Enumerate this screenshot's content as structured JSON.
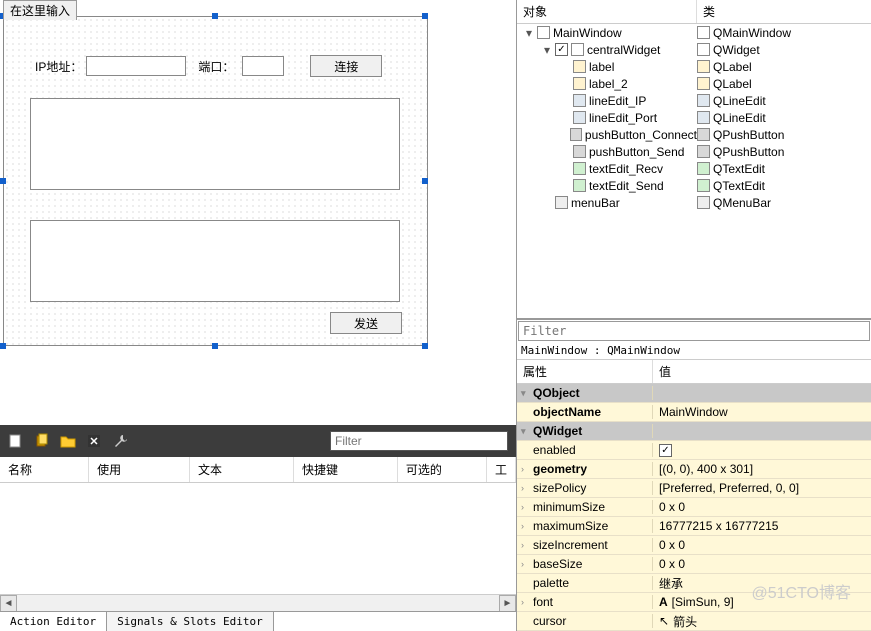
{
  "designer": {
    "tab_label": "在这里输入",
    "ip_label": "IP地址：",
    "port_label": "端口：",
    "connect_btn": "连接",
    "send_btn": "发送"
  },
  "action_filter_placeholder": "Filter",
  "action_headers": {
    "name": "名称",
    "use": "使用",
    "text": "文本",
    "shortcut": "快捷键",
    "optional": "可选的",
    "tool": "工"
  },
  "bottom_tabs": {
    "action": "Action Editor",
    "signals": "Signals & Slots Editor"
  },
  "obj_headers": {
    "obj": "对象",
    "cls": "类"
  },
  "obj_tree": [
    {
      "i": 0,
      "exp": "▾",
      "name": "MainWindow",
      "cls": "QMainWindow",
      "icon": "window"
    },
    {
      "i": 1,
      "exp": "▾",
      "name": "centralWidget",
      "cls": "QWidget",
      "icon": "window",
      "chk": true
    },
    {
      "i": 2,
      "exp": "",
      "name": "label",
      "cls": "QLabel",
      "icon": "label"
    },
    {
      "i": 2,
      "exp": "",
      "name": "label_2",
      "cls": "QLabel",
      "icon": "label"
    },
    {
      "i": 2,
      "exp": "",
      "name": "lineEdit_IP",
      "cls": "QLineEdit",
      "icon": "line"
    },
    {
      "i": 2,
      "exp": "",
      "name": "lineEdit_Port",
      "cls": "QLineEdit",
      "icon": "line"
    },
    {
      "i": 2,
      "exp": "",
      "name": "pushButton_Connect",
      "cls": "QPushButton",
      "icon": "btn"
    },
    {
      "i": 2,
      "exp": "",
      "name": "pushButton_Send",
      "cls": "QPushButton",
      "icon": "btn"
    },
    {
      "i": 2,
      "exp": "",
      "name": "textEdit_Recv",
      "cls": "QTextEdit",
      "icon": "text"
    },
    {
      "i": 2,
      "exp": "",
      "name": "textEdit_Send",
      "cls": "QTextEdit",
      "icon": "text"
    },
    {
      "i": 1,
      "exp": "",
      "name": "menuBar",
      "cls": "QMenuBar",
      "icon": "menu"
    }
  ],
  "prop_filter_placeholder": "Filter",
  "prop_path": "MainWindow : QMainWindow",
  "prop_headers": {
    "attr": "属性",
    "val": "值"
  },
  "properties": [
    {
      "type": "group",
      "key": "QObject",
      "exp": "▾"
    },
    {
      "type": "yellow",
      "key": "objectName",
      "val": "MainWindow",
      "bold": true
    },
    {
      "type": "group",
      "key": "QWidget",
      "exp": "▾"
    },
    {
      "type": "yellow",
      "key": "enabled",
      "val": "",
      "checkbox": true
    },
    {
      "type": "yellow",
      "key": "geometry",
      "val": "[(0, 0), 400 x 301]",
      "exp": "›",
      "bold": true
    },
    {
      "type": "yellow",
      "key": "sizePolicy",
      "val": "[Preferred, Preferred, 0, 0]",
      "exp": "›"
    },
    {
      "type": "yellow",
      "key": "minimumSize",
      "val": "0 x 0",
      "exp": "›"
    },
    {
      "type": "yellow",
      "key": "maximumSize",
      "val": "16777215 x 16777215",
      "exp": "›"
    },
    {
      "type": "yellow",
      "key": "sizeIncrement",
      "val": "0 x 0",
      "exp": "›"
    },
    {
      "type": "yellow",
      "key": "baseSize",
      "val": "0 x 0",
      "exp": "›"
    },
    {
      "type": "yellow",
      "key": "palette",
      "val": "继承"
    },
    {
      "type": "yellow",
      "key": "font",
      "val": "[SimSun, 9]",
      "exp": "›",
      "fonticon": true
    },
    {
      "type": "yellow",
      "key": "cursor",
      "val": "箭头",
      "cursoricon": true
    }
  ],
  "watermark": "@51CTO博客"
}
